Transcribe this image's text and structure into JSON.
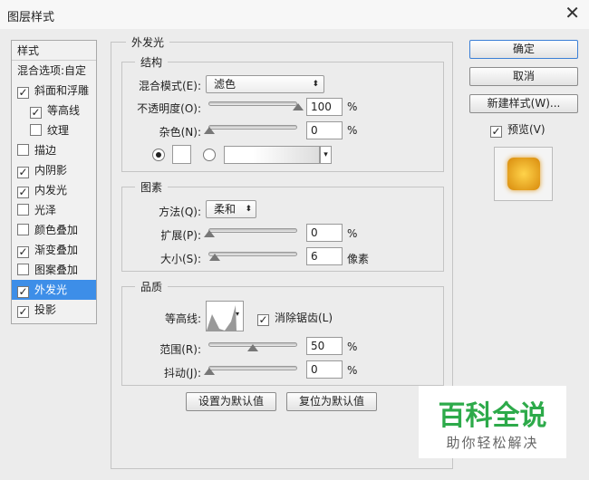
{
  "window": {
    "title": "图层样式",
    "close": "✕"
  },
  "sidebar": {
    "header": "样式",
    "blend_options": "混合选项:自定",
    "items": [
      {
        "label": "斜面和浮雕",
        "checked": true,
        "indent": false
      },
      {
        "label": "等高线",
        "checked": true,
        "indent": true
      },
      {
        "label": "纹理",
        "checked": false,
        "indent": true
      },
      {
        "label": "描边",
        "checked": false,
        "indent": false
      },
      {
        "label": "内阴影",
        "checked": true,
        "indent": false
      },
      {
        "label": "内发光",
        "checked": true,
        "indent": false
      },
      {
        "label": "光泽",
        "checked": false,
        "indent": false
      },
      {
        "label": "颜色叠加",
        "checked": false,
        "indent": false
      },
      {
        "label": "渐变叠加",
        "checked": true,
        "indent": false
      },
      {
        "label": "图案叠加",
        "checked": false,
        "indent": false
      },
      {
        "label": "外发光",
        "checked": true,
        "indent": false,
        "selected": true
      },
      {
        "label": "投影",
        "checked": true,
        "indent": false
      }
    ]
  },
  "panel": {
    "title": "外发光",
    "structure": {
      "title": "结构",
      "blend_label": "混合模式(E):",
      "blend_value": "滤色",
      "opacity_label": "不透明度(O):",
      "opacity": "100",
      "noise_label": "杂色(N):",
      "noise": "0",
      "pct": "%"
    },
    "elements": {
      "title": "图素",
      "method_label": "方法(Q):",
      "method_value": "柔和",
      "spread_label": "扩展(P):",
      "spread": "0",
      "size_label": "大小(S):",
      "size": "6",
      "size_unit": "像素"
    },
    "quality": {
      "title": "品质",
      "contour_label": "等高线:",
      "antialias_label": "消除锯齿(L)",
      "range_label": "范围(R):",
      "range": "50",
      "jitter_label": "抖动(J):",
      "jitter": "0"
    },
    "set_default": "设置为默认值",
    "reset_default": "复位为默认值"
  },
  "right": {
    "ok": "确定",
    "cancel": "取消",
    "new_style": "新建样式(W)...",
    "preview": "预览(V)"
  },
  "watermark": {
    "title": "百科全说",
    "subtitle": "助你轻松解决"
  }
}
